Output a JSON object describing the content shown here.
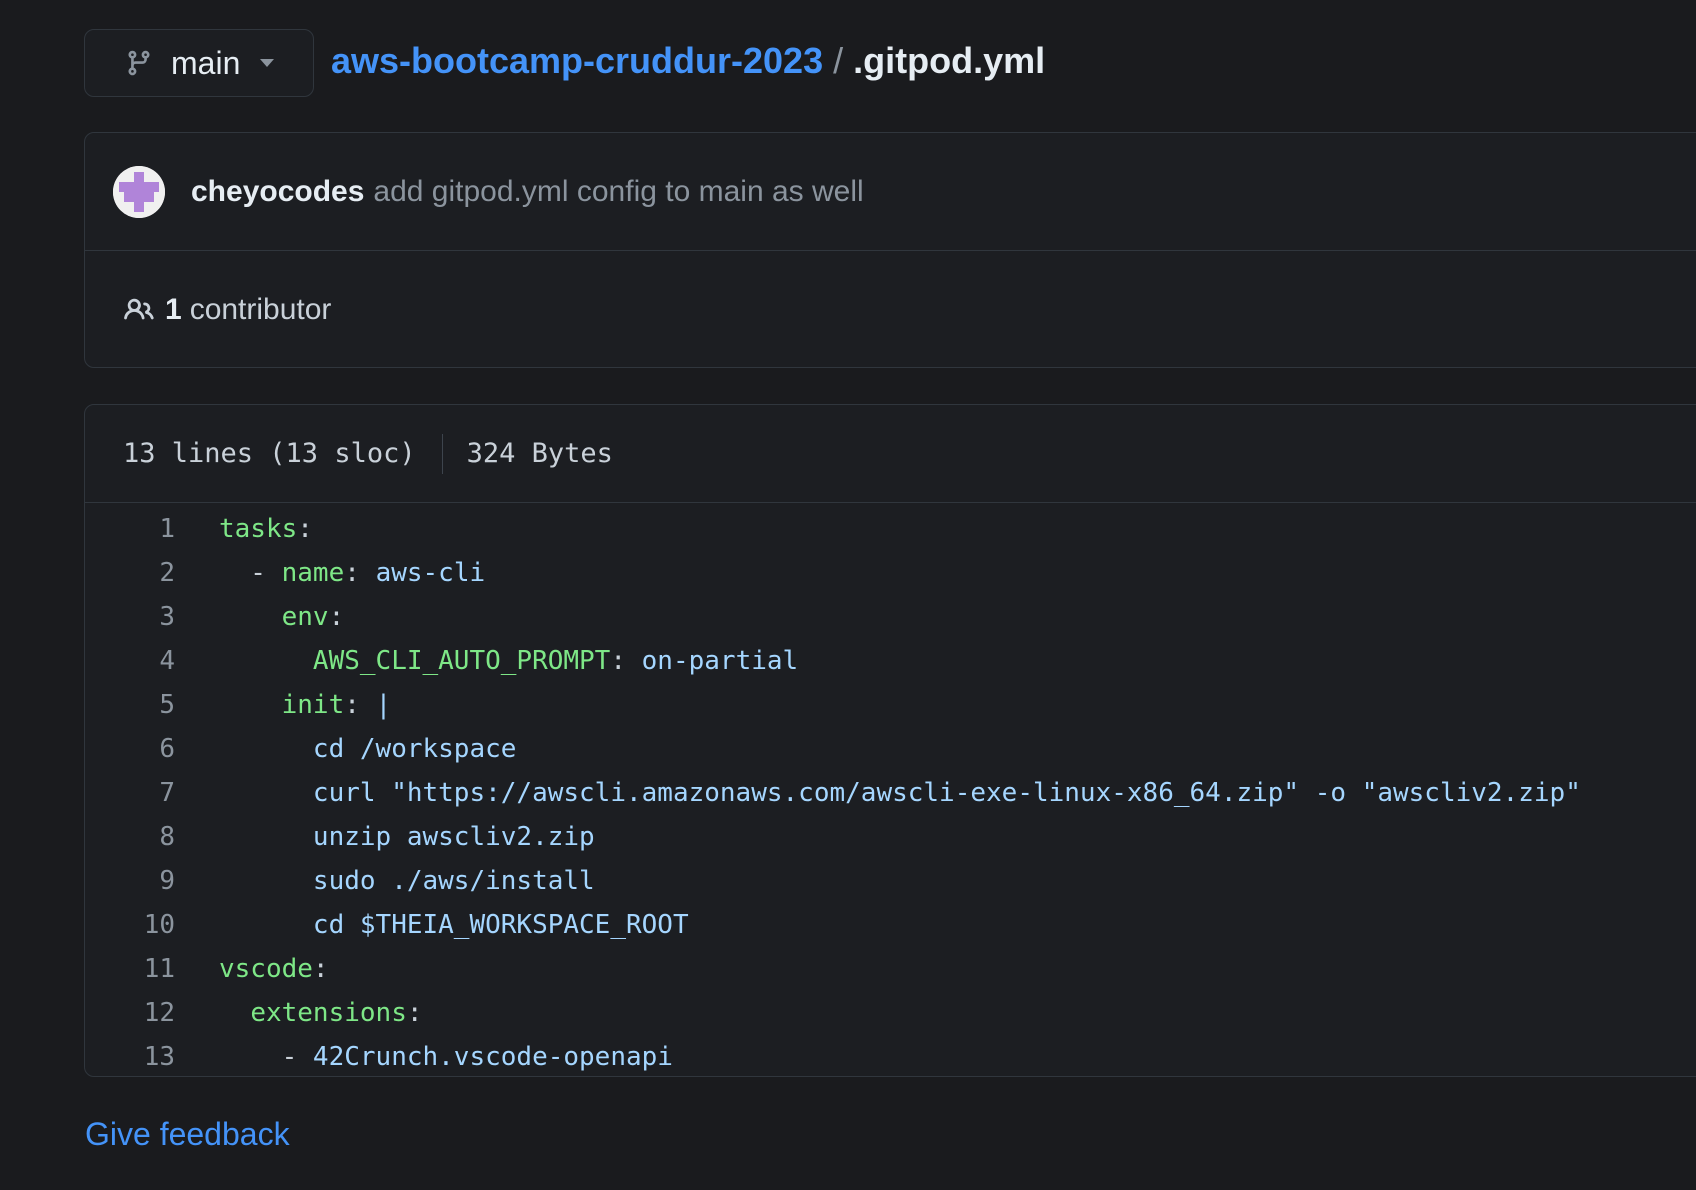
{
  "branch": {
    "name": "main",
    "icon": "git-branch-icon"
  },
  "breadcrumb": {
    "repo": "aws-bootcamp-cruddur-2023",
    "separator": "/",
    "file": ".gitpod.yml"
  },
  "commit": {
    "author": "cheyocodes",
    "message": "add gitpod.yml config to main as well"
  },
  "contributors": {
    "count": "1",
    "label": "contributor",
    "icon": "people-icon"
  },
  "file_info": {
    "lines": "13 lines (13 sloc)",
    "size": "324 Bytes"
  },
  "code": {
    "line_numbers": [
      "1",
      "2",
      "3",
      "4",
      "5",
      "6",
      "7",
      "8",
      "9",
      "10",
      "11",
      "12",
      "13"
    ],
    "lines": [
      {
        "indent": "",
        "key": "tasks",
        "colon": ":",
        "value": ""
      },
      {
        "indent": "  - ",
        "key": "name",
        "colon": ": ",
        "value": "aws-cli"
      },
      {
        "indent": "    ",
        "key": "env",
        "colon": ":",
        "value": ""
      },
      {
        "indent": "      ",
        "key": "AWS_CLI_AUTO_PROMPT",
        "colon": ": ",
        "value": "on-partial"
      },
      {
        "indent": "    ",
        "key": "init",
        "colon": ": ",
        "value": "|"
      },
      {
        "indent": "      ",
        "key": "",
        "colon": "",
        "value": "cd /workspace"
      },
      {
        "indent": "      ",
        "key": "",
        "colon": "",
        "value": "curl \"https://awscli.amazonaws.com/awscli-exe-linux-x86_64.zip\" -o \"awscliv2.zip\""
      },
      {
        "indent": "      ",
        "key": "",
        "colon": "",
        "value": "unzip awscliv2.zip"
      },
      {
        "indent": "      ",
        "key": "",
        "colon": "",
        "value": "sudo ./aws/install"
      },
      {
        "indent": "      ",
        "key": "",
        "colon": "",
        "value": "cd $THEIA_WORKSPACE_ROOT"
      },
      {
        "indent": "",
        "key": "vscode",
        "colon": ":",
        "value": ""
      },
      {
        "indent": "  ",
        "key": "extensions",
        "colon": ":",
        "value": ""
      },
      {
        "indent": "    - ",
        "key": "",
        "colon": "",
        "value": "42Crunch.vscode-openapi"
      }
    ]
  },
  "feedback": {
    "label": "Give feedback"
  },
  "colors": {
    "background": "#1a1b1e",
    "link": "#4493f8",
    "yaml_key": "#7ee787",
    "yaml_value": "#a5d6ff"
  }
}
